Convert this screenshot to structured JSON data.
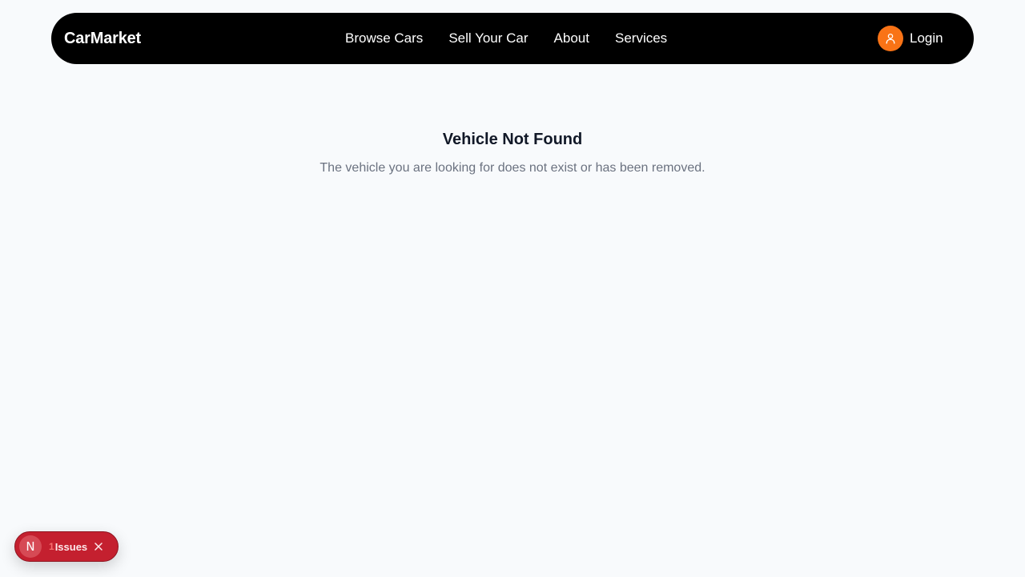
{
  "navbar": {
    "brand": "CarMarket",
    "links": [
      {
        "label": "Browse Cars"
      },
      {
        "label": "Sell Your Car"
      },
      {
        "label": "About"
      },
      {
        "label": "Services"
      }
    ],
    "login_label": "Login",
    "login_icon": "user-icon",
    "accent_color": "#f97316"
  },
  "content": {
    "title": "Vehicle Not Found",
    "message": "The vehicle you are looking for does not exist or has been removed."
  },
  "dev_indicator": {
    "badge_letter": "N",
    "issues_count": "1",
    "issues_label": "Issues",
    "close_icon": "close-icon",
    "color": "#c4202f"
  }
}
